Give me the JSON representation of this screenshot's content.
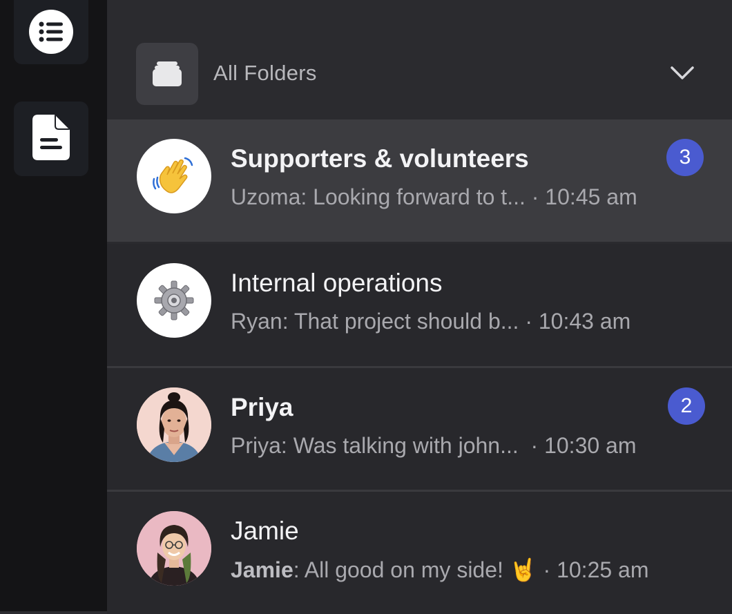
{
  "rail": {
    "items": [
      {
        "name": "list-icon"
      },
      {
        "name": "document-icon"
      }
    ]
  },
  "folder": {
    "label": "All Folders",
    "icon": "folder-stack-icon"
  },
  "conversations": [
    {
      "title": "Supporters & volunteers",
      "sender": "Uzoma",
      "message": "Looking forward to t...",
      "time": "10:45 am",
      "unread": "3",
      "active": true,
      "bold": true,
      "avatar": "waving-hand-icon"
    },
    {
      "title": "Internal operations",
      "sender": "Ryan",
      "message": "That project should b...",
      "time": "10:43 am",
      "unread": "",
      "active": false,
      "bold": false,
      "avatar": "gear-icon"
    },
    {
      "title": "Priya",
      "sender": "Priya",
      "message": "Was talking with john...",
      "time": "10:30 am",
      "unread": "2",
      "active": false,
      "bold": true,
      "avatar": "priya-avatar"
    },
    {
      "title": "Jamie",
      "sender": "Jamie",
      "message": "All good on my side! 🤘",
      "time": "10:25 am",
      "unread": "",
      "active": false,
      "bold": false,
      "avatar": "jamie-avatar"
    }
  ],
  "colors": {
    "accent_badge": "#4a5bd0",
    "background": "#2b2b2f",
    "rail": "#141416"
  }
}
